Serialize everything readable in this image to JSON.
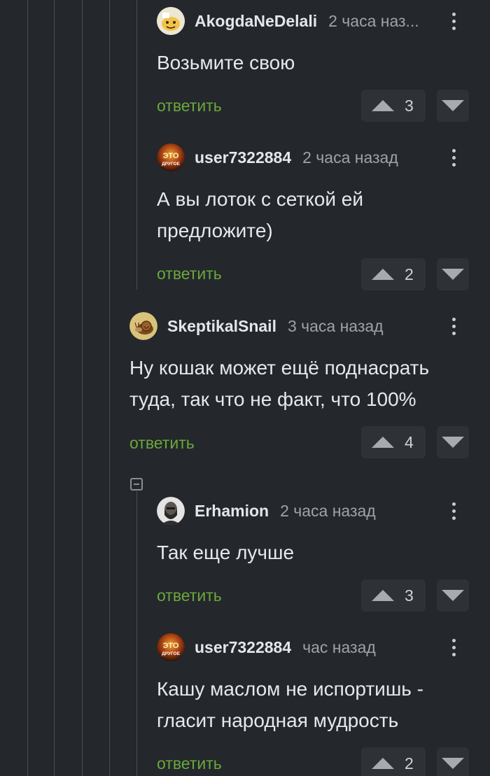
{
  "colors": {
    "background": "#24272b",
    "reply_link": "#6aa83c",
    "vote_bg": "#2e3236",
    "thread_line": "#4a4e54"
  },
  "comments": [
    {
      "author": "AkogdaNeDelali",
      "time": "2 часа наз...",
      "text": "Возьмите свою",
      "reply": "ответить",
      "votes": "3",
      "avatar_icon": "smiley-avatar-icon"
    },
    {
      "author": "user7322884",
      "time": "2 часа назад",
      "text": "А вы лоток с сеткой ей\nпредложите)",
      "reply": "ответить",
      "votes": "2",
      "avatar_icon": "eto-drugoe-avatar-icon"
    },
    {
      "author": "SkeptikalSnail",
      "time": "3 часа назад",
      "text": "Ну кошак может ещё поднасрать\nтуда, так что не факт, что 100%",
      "reply": "ответить",
      "votes": "4",
      "avatar_icon": "snail-avatar-icon"
    },
    {
      "author": "Erhamion",
      "time": "2 часа назад",
      "text": "Так еще лучше",
      "reply": "ответить",
      "votes": "3",
      "avatar_icon": "person-avatar-icon"
    },
    {
      "author": "user7322884",
      "time": "час назад",
      "text": "Кашу маслом не испортишь -\nгласит народная мудрость",
      "reply": "ответить",
      "votes": "2",
      "avatar_icon": "eto-drugoe-avatar-icon"
    }
  ],
  "badge_text": {
    "eto": "ЭТО",
    "drugoe": "ДРУГОЕ"
  }
}
